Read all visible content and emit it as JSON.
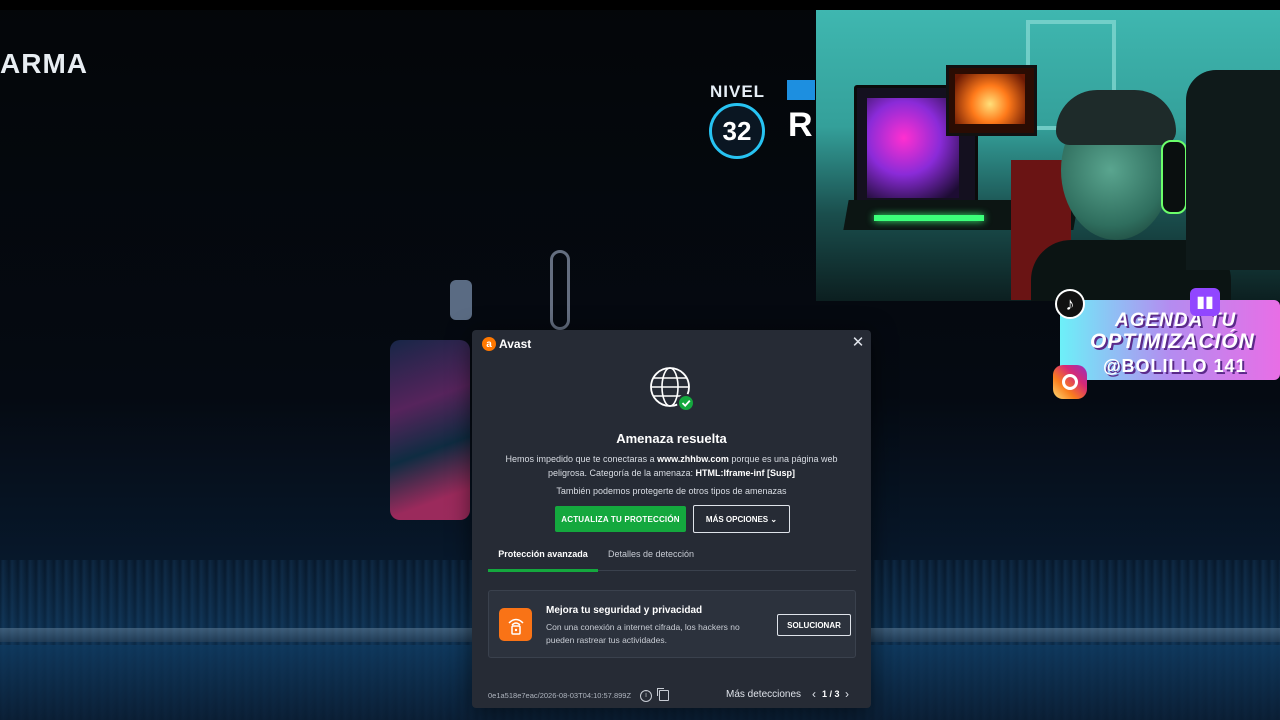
{
  "game": {
    "weapon_label": "ARMA",
    "level_label": "NIVEL",
    "level_value": "32",
    "rank_letter": "R"
  },
  "overlay": {
    "promo_line1": "AGENDA TU",
    "promo_line2": "OPTIMIZACIÓN",
    "promo_line3": "@BOLILLO 141"
  },
  "dialog": {
    "brand": "Avast",
    "close_glyph": "✕",
    "title": "Amenaza resuelta",
    "message_part1": "Hemos impedido que te conectaras a ",
    "message_domain": "www.zhhbw.com",
    "message_part2": " porque es una página web peligrosa. Categoría de la amenaza: ",
    "message_category": "HTML:Iframe-inf [Susp]",
    "subtitle": "También podemos protegerte de otros tipos de amenazas",
    "primary_button": "ACTUALIZA TU PROTECCIÓN",
    "secondary_button": "MÁS OPCIONES",
    "tabs": [
      {
        "label": "Protección avanzada",
        "active": true
      },
      {
        "label": "Detalles de detección",
        "active": false
      }
    ],
    "card": {
      "title": "Mejora tu seguridad y privacidad",
      "text": "Con una conexión a internet cifrada, los hackers no pueden rastrear tus actividades.",
      "button": "SOLUCIONAR",
      "icon": "vpn-lock-icon"
    },
    "footer": {
      "detection_id": "0e1a518e7eac/2026-08-03T04:10:57.899Z",
      "more_detections": "Más detecciones",
      "pager": "1 / 3"
    }
  },
  "colors": {
    "dialog_bg": "#262b35",
    "primary_green": "#14a83e",
    "avast_orange": "#ff7800",
    "card_icon_orange": "#f97316"
  }
}
